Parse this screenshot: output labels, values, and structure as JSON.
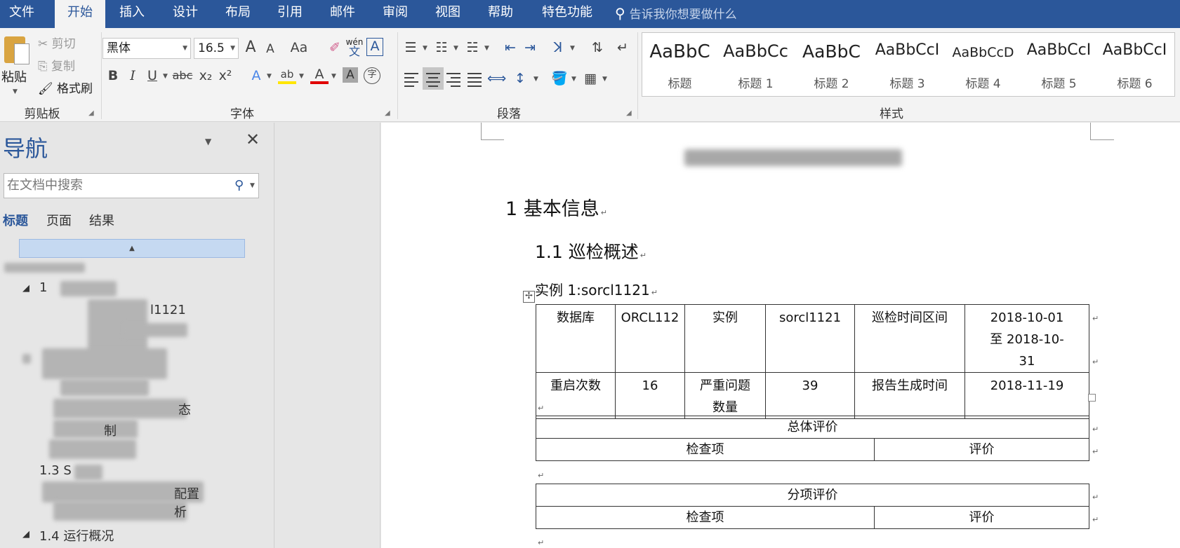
{
  "menubar": {
    "tabs": [
      "文件",
      "开始",
      "插入",
      "设计",
      "布局",
      "引用",
      "邮件",
      "审阅",
      "视图",
      "帮助",
      "特色功能"
    ],
    "active_tab": "开始",
    "tell_me": "告诉我你想要做什么"
  },
  "ribbon": {
    "clipboard": {
      "paste": "粘贴",
      "cut": "剪切",
      "copy": "复制",
      "format_painter": "格式刷",
      "group_label": "剪贴板"
    },
    "font": {
      "font_name": "黑体",
      "font_size": "16.5",
      "grow": "A",
      "shrink": "A",
      "case": "Aa",
      "bold": "B",
      "italic": "I",
      "underline": "U",
      "strike": "abc",
      "subscript": "x₂",
      "superscript": "x²",
      "phonetic_top": "wén",
      "phonetic_bottom": "文",
      "border_char": "A",
      "effects": "A",
      "highlight": "ab",
      "font_color": "A",
      "shading": "A",
      "enclose": "字",
      "group_label": "字体"
    },
    "paragraph": {
      "group_label": "段落"
    },
    "styles": {
      "group_label": "样式",
      "items": [
        {
          "sample": "AaBbC",
          "name": "标题"
        },
        {
          "sample": "AaBbCc",
          "name": "标题 1"
        },
        {
          "sample": "AaBbC",
          "name": "标题 2"
        },
        {
          "sample": "AaBbCcI",
          "name": "标题 3"
        },
        {
          "sample": "AaBbCcD",
          "name": "标题 4"
        },
        {
          "sample": "AaBbCcI",
          "name": "标题 5"
        },
        {
          "sample": "AaBbCcI",
          "name": "标题 6"
        }
      ]
    }
  },
  "navigation": {
    "title": "导航",
    "search_placeholder": "在文档中搜索",
    "tabs": [
      "标题",
      "页面",
      "结果"
    ],
    "active_tab": "标题",
    "tree_fragments": {
      "item_1_prefix": "1",
      "item_instance_suffix": "l1121",
      "item_state_suffix": "态",
      "item_system_suffix": "制",
      "item_1_3": "1.3 S",
      "item_config_suffix": "配置",
      "item_analysis_suffix": "析",
      "item_1_4": "1.4 运行概况"
    }
  },
  "document": {
    "heading1": "1  基本信息",
    "heading2": "1.1  巡检概述",
    "instance_line": "实例 1:sorcl1121",
    "info_table": [
      [
        "数据库",
        "ORCL112",
        "实例",
        "sorcl1121",
        "巡检时间区间",
        "2018-10-01 至 2018-10-31"
      ],
      [
        "重启次数",
        "16",
        "严重问题数量",
        "39",
        "报告生成时间",
        "2018-11-19"
      ]
    ],
    "overall_table": {
      "title": "总体评价",
      "col1": "检查项",
      "col2": "评价"
    },
    "item_table": {
      "title": "分项评价",
      "col1": "检查项",
      "col2": "评价"
    }
  }
}
